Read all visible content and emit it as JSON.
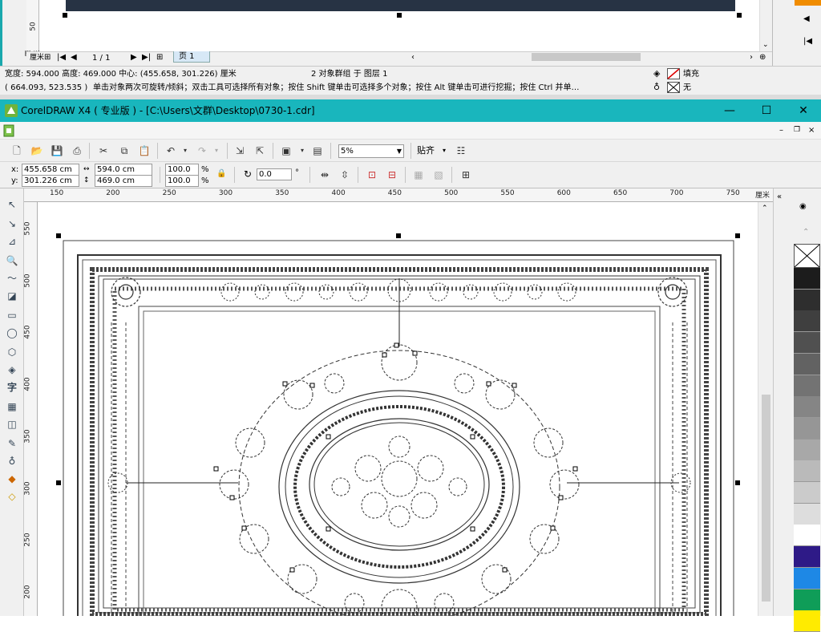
{
  "prev_window": {
    "ruler_label": "50",
    "ruler_unit": "厘米",
    "page_nav": {
      "current": "1 / 1",
      "tab": "页 1"
    },
    "status_line1": {
      "dims": "宽度: 594.000  高度: 469.000  中心: (455.658, 301.226)  厘米",
      "selection": "2 对象群组 于 图层 1",
      "fill_label": "填充"
    },
    "status_line2": {
      "cursor": "( 664.093, 523.535 )",
      "hint": "单击对象两次可旋转/倾斜；双击工具可选择所有对象；按住 Shift 键单击可选择多个对象；按住 Alt 键单击可进行挖掘；按住 Ctrl 并单…",
      "outline_label": "无"
    }
  },
  "titlebar": {
    "title": "CorelDRAW X4 ( 专业版 ) - [C:\\Users\\文群\\Desktop\\0730-1.cdr]",
    "minimize": "—",
    "maximize": "☐",
    "close": "✕"
  },
  "toolbar": {
    "zoom": "5%",
    "snap_label": "贴齐"
  },
  "property_bar": {
    "x_label": "x:",
    "y_label": "y:",
    "x_value": "455.658 cm",
    "y_value": "301.226 cm",
    "width_value": "594.0 cm",
    "height_value": "469.0 cm",
    "scale_x": "100.0",
    "scale_y": "100.0",
    "percent": "%",
    "rotation": "0.0",
    "degree": "°"
  },
  "ruler": {
    "unit": "厘米",
    "h_ticks": [
      "150",
      "200",
      "250",
      "300",
      "350",
      "400",
      "450",
      "500",
      "550",
      "600",
      "650",
      "700",
      "750"
    ],
    "v_ticks": [
      "550",
      "500",
      "450",
      "400",
      "350",
      "300",
      "250",
      "200"
    ]
  },
  "palette": {
    "colors": [
      "#1c1c1c",
      "#2e2e2e",
      "#3f3f3f",
      "#505050",
      "#626262",
      "#737373",
      "#858585",
      "#969696",
      "#a8a8a8",
      "#bababa",
      "#cbcbcb",
      "#dddddd",
      "#ffffff",
      "#2e1a87",
      "#1e88e5",
      "#0f9d58",
      "#ffeb00"
    ]
  },
  "colors": {
    "title_bar": "#19b6bd",
    "dark_bar": "#273344",
    "accent_orange": "#f08c00"
  }
}
